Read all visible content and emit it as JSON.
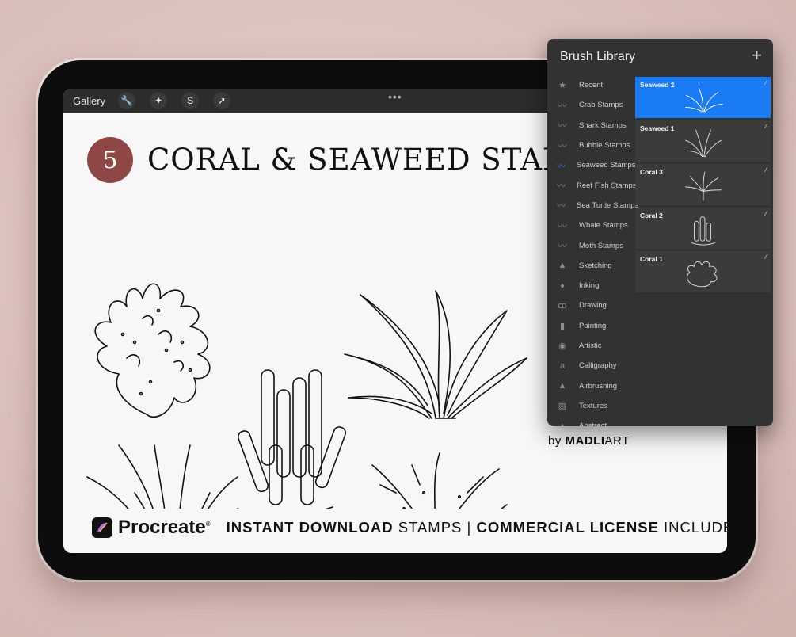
{
  "toolbar": {
    "gallery_label": "Gallery",
    "tools": [
      {
        "name": "wrench-icon",
        "glyph": "🔧"
      },
      {
        "name": "magic-wand-icon",
        "glyph": "✦"
      },
      {
        "name": "selection-icon",
        "glyph": "S"
      },
      {
        "name": "transform-arrow-icon",
        "glyph": "➚"
      }
    ],
    "more_glyph": "•••"
  },
  "header": {
    "badge_number": "5",
    "title": "CORAL & SEAWEED STAMPS"
  },
  "footer": {
    "app_name": "Procreate",
    "trademark": "®",
    "tagline_bold_1": "INSTANT DOWNLOAD",
    "tagline_regular_1": " STAMPS | ",
    "tagline_bold_2": "COMMERCIAL LICENSE",
    "tagline_regular_2": " INCLUDED"
  },
  "byline": {
    "prefix": "by ",
    "brand_bold": "MADLI",
    "brand_regular": "ART"
  },
  "brush_library": {
    "title": "Brush Library",
    "add_glyph": "+",
    "accent_color": "#1a7cf5",
    "categories": [
      {
        "label": "Recent",
        "icon": "star-icon",
        "glyph": "★"
      },
      {
        "label": "Crab Stamps",
        "icon": "brush-stroke-icon",
        "glyph": "〰"
      },
      {
        "label": "Shark Stamps",
        "icon": "brush-stroke-icon",
        "glyph": "〰"
      },
      {
        "label": "Bubble Stamps",
        "icon": "brush-stroke-icon",
        "glyph": "〰"
      },
      {
        "label": "Seaweed Stamps",
        "icon": "brush-stroke-icon",
        "glyph": "〰",
        "active": true
      },
      {
        "label": "Reef Fish Stamps",
        "icon": "brush-stroke-icon",
        "glyph": "〰"
      },
      {
        "label": "Sea Turtle Stamps",
        "icon": "brush-stroke-icon",
        "glyph": "〰"
      },
      {
        "label": "Whale Stamps",
        "icon": "brush-stroke-icon",
        "glyph": "〰"
      },
      {
        "label": "Moth Stamps",
        "icon": "brush-stroke-icon",
        "glyph": "〰"
      },
      {
        "label": "Sketching",
        "icon": "pencil-tip-icon",
        "glyph": "▲"
      },
      {
        "label": "Inking",
        "icon": "ink-drop-icon",
        "glyph": "♦"
      },
      {
        "label": "Drawing",
        "icon": "swirl-icon",
        "glyph": "ꝏ"
      },
      {
        "label": "Painting",
        "icon": "paint-brush-icon",
        "glyph": "▮"
      },
      {
        "label": "Artistic",
        "icon": "palette-icon",
        "glyph": "◉"
      },
      {
        "label": "Calligraphy",
        "icon": "calligraphy-icon",
        "glyph": "a"
      },
      {
        "label": "Airbrushing",
        "icon": "airbrush-icon",
        "glyph": "▲"
      },
      {
        "label": "Textures",
        "icon": "texture-icon",
        "glyph": "▨"
      },
      {
        "label": "Abstract",
        "icon": "abstract-icon",
        "glyph": "▲"
      }
    ],
    "brushes": [
      {
        "name": "Seaweed 2",
        "active": true,
        "kind": "seaweed"
      },
      {
        "name": "Seaweed 1",
        "active": false,
        "kind": "grass"
      },
      {
        "name": "Coral 3",
        "active": false,
        "kind": "branch"
      },
      {
        "name": "Coral 2",
        "active": false,
        "kind": "tube"
      },
      {
        "name": "Coral 1",
        "active": false,
        "kind": "blob"
      }
    ],
    "brush_edit_glyph": "⁄"
  }
}
